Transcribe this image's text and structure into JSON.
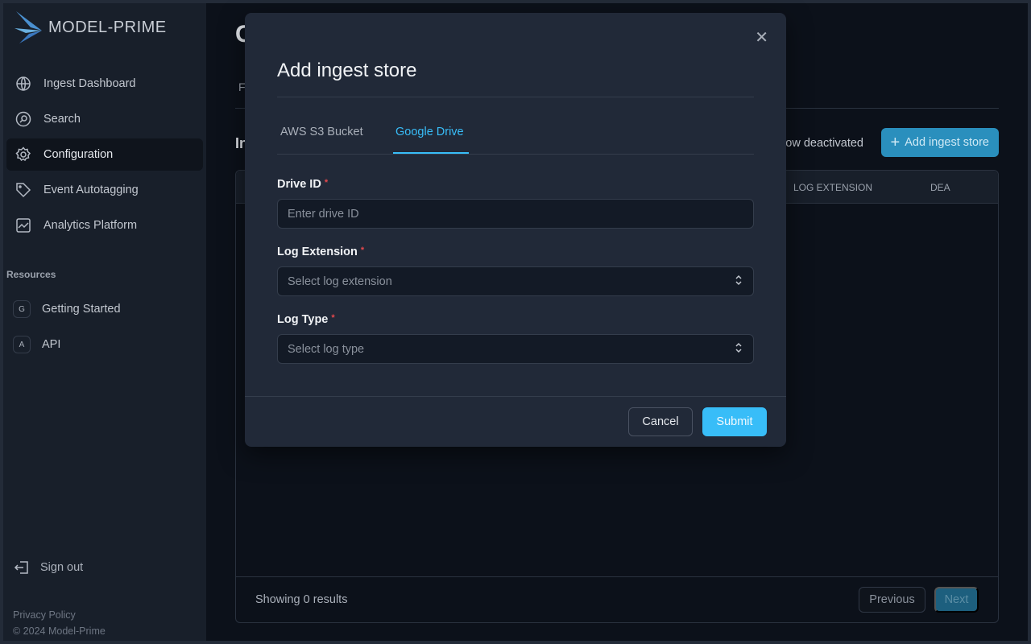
{
  "brand": {
    "name": "MODEL-PRIME"
  },
  "sidebar": {
    "items": [
      {
        "label": "Ingest Dashboard",
        "icon": "globe-download-icon"
      },
      {
        "label": "Search",
        "icon": "search-icon"
      },
      {
        "label": "Configuration",
        "icon": "gear-icon",
        "active": true
      },
      {
        "label": "Event Autotagging",
        "icon": "tag-icon"
      },
      {
        "label": "Analytics Platform",
        "icon": "chart-icon"
      }
    ],
    "resources_label": "Resources",
    "resources": [
      {
        "letter": "G",
        "label": "Getting Started"
      },
      {
        "letter": "A",
        "label": "API"
      }
    ],
    "sign_out": "Sign out",
    "privacy": "Privacy Policy",
    "copyright": "© 2024 Model-Prime"
  },
  "main": {
    "title": "C",
    "subnav": "F",
    "section_title": "In",
    "show_deactivated": "ow deactivated",
    "add_button": "Add ingest store",
    "columns": [
      "LOG EXTENSION",
      "DEA"
    ],
    "results": "Showing 0 results",
    "previous": "Previous",
    "next": "Next"
  },
  "modal": {
    "title": "Add ingest store",
    "tabs": [
      {
        "label": "AWS S3 Bucket"
      },
      {
        "label": "Google Drive",
        "active": true
      }
    ],
    "fields": [
      {
        "label": "Drive ID",
        "placeholder": "Enter drive ID",
        "required": "*"
      },
      {
        "label": "Log Extension",
        "placeholder": "Select log extension",
        "required": "*"
      },
      {
        "label": "Log Type",
        "placeholder": "Select log type",
        "required": "*"
      }
    ],
    "cancel": "Cancel",
    "submit": "Submit"
  },
  "colors": {
    "accent": "#38bdf8",
    "button": "#2a8fbd",
    "required": "#e5484d"
  }
}
